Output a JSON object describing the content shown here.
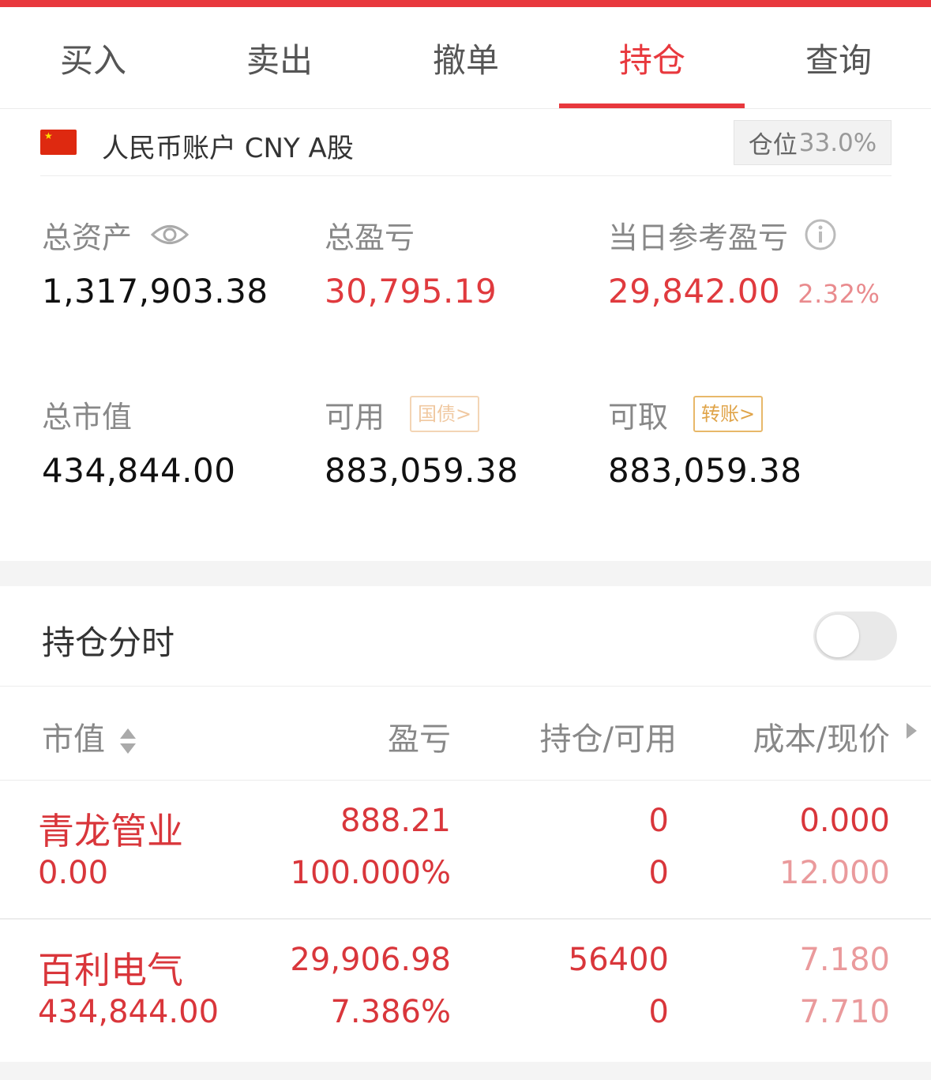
{
  "tabs": [
    {
      "label": "买入"
    },
    {
      "label": "卖出"
    },
    {
      "label": "撤单"
    },
    {
      "label": "持仓",
      "active": true
    },
    {
      "label": "查询"
    }
  ],
  "account": {
    "flag": "china-flag-icon",
    "title": "人民币账户 CNY A股",
    "position_label": "仓位",
    "position_value": "33.0%"
  },
  "stats": {
    "total_assets": {
      "label": "总资产",
      "value": "1,317,903.38",
      "icon": "eye-icon"
    },
    "total_pnl": {
      "label": "总盈亏",
      "value": "30,795.19"
    },
    "daily_pnl": {
      "label": "当日参考盈亏",
      "value": "29,842.00",
      "pct": "2.32%",
      "icon": "info-icon"
    },
    "market_value": {
      "label": "总市值",
      "value": "434,844.00"
    },
    "available": {
      "label": "可用",
      "value": "883,059.38",
      "chip": "国债>"
    },
    "withdrawable": {
      "label": "可取",
      "value": "883,059.38",
      "chip": "转账>"
    }
  },
  "holding_timeshare": {
    "label": "持仓分时",
    "enabled": false
  },
  "table": {
    "headers": {
      "market_value": "市值",
      "pnl": "盈亏",
      "position": "持仓/可用",
      "cost_price": "成本/现价"
    },
    "rows": [
      {
        "name": "青龙管业",
        "market_value": "0.00",
        "pnl": "888.21",
        "pnl_pct": "100.000%",
        "position": "0",
        "available": "0",
        "cost": "0.000",
        "price": "12.000"
      },
      {
        "name": "百利电气",
        "market_value": "434,844.00",
        "pnl": "29,906.98",
        "pnl_pct": "7.386%",
        "position": "56400",
        "available": "0",
        "cost": "7.180",
        "price": "7.710"
      }
    ]
  },
  "colors": {
    "accent": "#e8383d",
    "gain": "#d9363b",
    "gold": "#e0a449"
  }
}
